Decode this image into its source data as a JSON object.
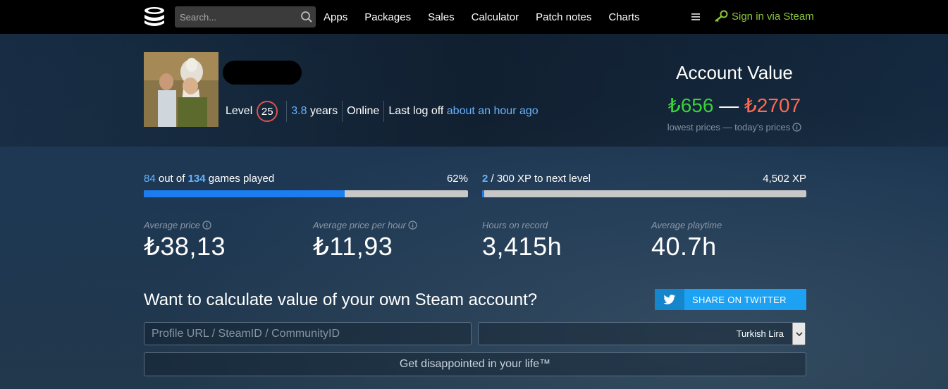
{
  "nav": {
    "search_placeholder": "Search...",
    "links": [
      "Apps",
      "Packages",
      "Sales",
      "Calculator",
      "Patch notes",
      "Charts"
    ],
    "signin_label": "Sign in via Steam"
  },
  "profile": {
    "level_label": "Level",
    "level": "25",
    "years_value": "3.8",
    "years_label": "years",
    "status": "Online",
    "last_logoff_label": "Last log off",
    "last_logoff_value": "about an hour ago"
  },
  "account_value": {
    "title": "Account Value",
    "low": "₺656",
    "dash": "—",
    "high": "₺2707",
    "subtitle": "lowest prices — today's prices"
  },
  "games_progress": {
    "played": "84",
    "out_of": "out of",
    "total": "134",
    "suffix": "games played",
    "percent_label": "62%",
    "fraction": 0.62
  },
  "xp_progress": {
    "current": "2",
    "suffix": "/ 300 XP to next level",
    "total_xp": "4,502 XP",
    "fraction": 0.0067
  },
  "stats": [
    {
      "label": "Average price",
      "value": "₺38,13"
    },
    {
      "label": "Average price per hour",
      "value": "₺11,93"
    },
    {
      "label": "Hours on record",
      "value": "3,415h"
    },
    {
      "label": "Average playtime",
      "value": "40.7h"
    }
  ],
  "calculator": {
    "title": "Want to calculate value of your own Steam account?",
    "twitter_label": "SHARE ON TWITTER",
    "profile_placeholder": "Profile URL / SteamID / CommunityID",
    "currency": "Turkish Lira",
    "submit_label": "Get disappointed in your life™"
  },
  "colors": {
    "accent_blue": "#1a7df0",
    "low_price": "#3ad13a",
    "high_price": "#ff6a50",
    "signin_green": "#8bc53f",
    "twitter": "#1da1f2"
  }
}
